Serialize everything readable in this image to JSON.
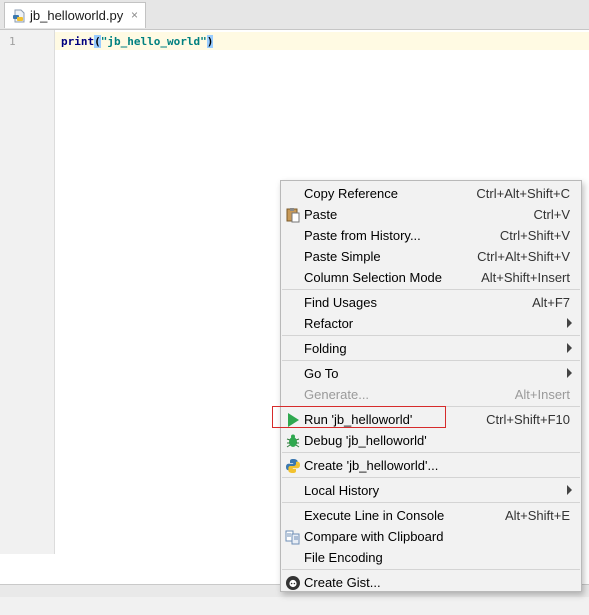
{
  "tab": {
    "label": "jb_helloworld.py",
    "close": "×"
  },
  "editor": {
    "line_number": "1",
    "code": {
      "kw": "print",
      "open": "(",
      "str": "\"jb_hello_world\"",
      "close": ")"
    }
  },
  "menu": {
    "items": [
      {
        "label": "Copy Reference",
        "shortcut": "Ctrl+Alt+Shift+C"
      },
      {
        "label": "Paste",
        "shortcut": "Ctrl+V"
      },
      {
        "label": "Paste from History...",
        "shortcut": "Ctrl+Shift+V"
      },
      {
        "label": "Paste Simple",
        "shortcut": "Ctrl+Alt+Shift+V"
      },
      {
        "label": "Column Selection Mode",
        "shortcut": "Alt+Shift+Insert"
      },
      {
        "label": "Find Usages",
        "shortcut": "Alt+F7"
      },
      {
        "label": "Refactor",
        "shortcut": ""
      },
      {
        "label": "Folding",
        "shortcut": ""
      },
      {
        "label": "Go To",
        "shortcut": ""
      },
      {
        "label": "Generate...",
        "shortcut": "Alt+Insert"
      },
      {
        "label": "Run 'jb_helloworld'",
        "shortcut": "Ctrl+Shift+F10"
      },
      {
        "label": "Debug 'jb_helloworld'",
        "shortcut": ""
      },
      {
        "label": "Create 'jb_helloworld'...",
        "shortcut": ""
      },
      {
        "label": "Local History",
        "shortcut": ""
      },
      {
        "label": "Execute Line in Console",
        "shortcut": "Alt+Shift+E"
      },
      {
        "label": "Compare with Clipboard",
        "shortcut": ""
      },
      {
        "label": "File Encoding",
        "shortcut": ""
      },
      {
        "label": "Create Gist...",
        "shortcut": ""
      }
    ]
  },
  "colors": {
    "highlight_border": "#d62b2b",
    "run_green": "#2fa84f",
    "python_blue": "#3b78b0",
    "python_yellow": "#f2c230"
  },
  "icons": [
    "python-file-icon",
    "paste-icon",
    "run-icon",
    "debug-icon",
    "python-icon",
    "compare-icon",
    "github-icon",
    "submenu-arrow-icon"
  ]
}
